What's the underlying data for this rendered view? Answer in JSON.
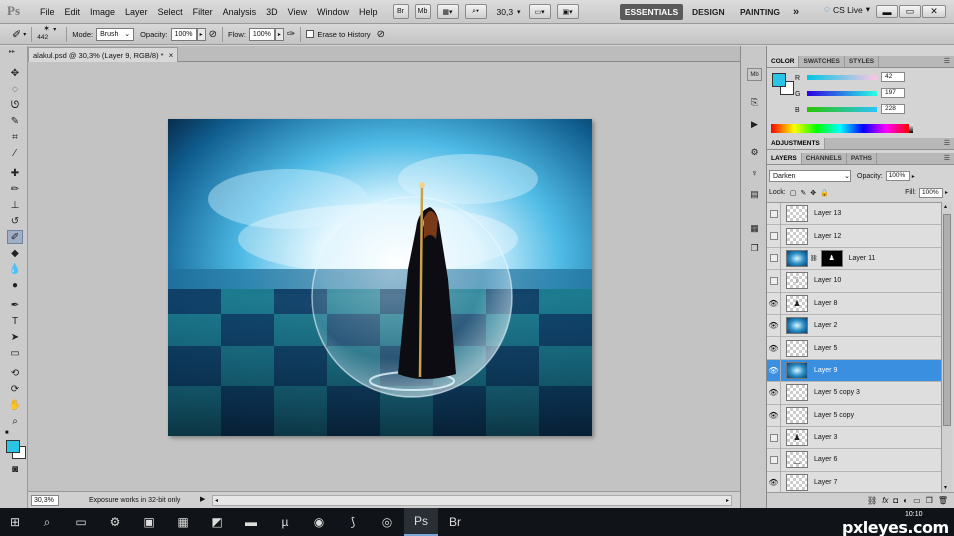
{
  "app": {
    "logo": "Ps"
  },
  "menu": [
    "File",
    "Edit",
    "Image",
    "Layer",
    "Select",
    "Filter",
    "Analysis",
    "3D",
    "View",
    "Window",
    "Help"
  ],
  "menubar_buttons": {
    "bridge": "Br",
    "minibridge": "Mb",
    "zoom_value": "30,3"
  },
  "workspaces": {
    "active": "ESSENTIALS",
    "design": "DESIGN",
    "painting": "PAINTING",
    "more": "»"
  },
  "cslive": "CS Live",
  "options": {
    "brush_size": "442",
    "mode_label": "Mode:",
    "mode_value": "Brush",
    "opacity_label": "Opacity:",
    "opacity_value": "100%",
    "flow_label": "Flow:",
    "flow_value": "100%",
    "erase_history_label": "Erase to History"
  },
  "document": {
    "tab_title": "alakul.psd @ 30,3% (Layer 9, RGB/8) *",
    "close": "×"
  },
  "status": {
    "zoom": "30,3%",
    "message": "Exposure works in 32-bit only"
  },
  "color_panel": {
    "tabs": [
      "COLOR",
      "SWATCHES",
      "STYLES"
    ],
    "r_label": "R",
    "r": "42",
    "g_label": "G",
    "g": "197",
    "b_label": "B",
    "b": "228",
    "fg_color": "#2ac5e4"
  },
  "adjustments": {
    "tab": "ADJUSTMENTS"
  },
  "layers_panel": {
    "tabs": [
      "LAYERS",
      "CHANNELS",
      "PATHS"
    ],
    "blend_mode": "Darken",
    "opacity_label": "Opacity:",
    "opacity": "100%",
    "lock_label": "Lock:",
    "fill_label": "Fill:",
    "fill": "100%",
    "layers": [
      {
        "name": "Layer 13",
        "visible": false
      },
      {
        "name": "Layer 12",
        "visible": false
      },
      {
        "name": "Layer 11",
        "visible": false
      },
      {
        "name": "Layer 10",
        "visible": false
      },
      {
        "name": "Layer 8",
        "visible": true
      },
      {
        "name": "Layer 2",
        "visible": true
      },
      {
        "name": "Layer 5",
        "visible": true
      },
      {
        "name": "Layer 9",
        "visible": true,
        "selected": true
      },
      {
        "name": "Layer 5 copy 3",
        "visible": true
      },
      {
        "name": "Layer 5 copy",
        "visible": true
      },
      {
        "name": "Layer 3",
        "visible": false
      },
      {
        "name": "Layer 6",
        "visible": false
      },
      {
        "name": "Layer 7",
        "visible": true
      }
    ]
  },
  "taskbar": {
    "time": "10:10",
    "watermark": "pxleyes.com"
  }
}
